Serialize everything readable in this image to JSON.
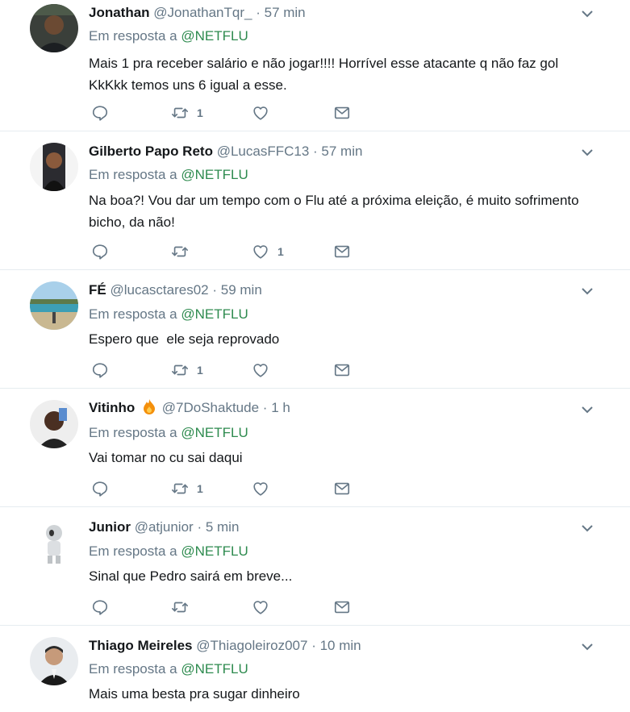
{
  "tweets": [
    {
      "name": "Jonathan",
      "handle": "@JonathanTqr_",
      "sep": "·",
      "time": "57 min",
      "reply_prefix": "Em resposta a",
      "reply_to": "@NETFLU",
      "lines": [
        "Mais 1 pra receber salário e não jogar!!!! Horrível esse atacante q não faz gol",
        "KkKkk temos uns 6 igual a esse."
      ],
      "retweets": "1",
      "likes": ""
    },
    {
      "name": "Gilberto Papo Reto",
      "handle": "@LucasFFC13",
      "sep": "·",
      "time": "57 min",
      "reply_prefix": "Em resposta a",
      "reply_to": "@NETFLU",
      "lines": [
        "Na boa?! Vou dar um tempo com o Flu até a próxima eleição, é muito sofrimento",
        "bicho, da não!"
      ],
      "retweets": "",
      "likes": "1"
    },
    {
      "name": "FÉ",
      "handle": "@lucasctares02",
      "sep": "·",
      "time": "59 min",
      "reply_prefix": "Em resposta a",
      "reply_to": "@NETFLU",
      "lines": [
        "Espero que  ele seja reprovado"
      ],
      "retweets": "1",
      "likes": ""
    },
    {
      "name": "Vitinho",
      "handle": "@7DoShaktude",
      "sep": "·",
      "time": "1 h",
      "reply_prefix": "Em resposta a",
      "reply_to": "@NETFLU",
      "lines": [
        "Vai tomar no cu sai daqui"
      ],
      "retweets": "1",
      "likes": ""
    },
    {
      "name": "Junior",
      "handle": "@atjunior",
      "sep": "·",
      "time": "5 min",
      "reply_prefix": "Em resposta a",
      "reply_to": "@NETFLU",
      "lines": [
        "Sinal que Pedro sairá em breve..."
      ],
      "retweets": "",
      "likes": ""
    },
    {
      "name": "Thiago Meireles",
      "handle": "@Thiagoleiroz007",
      "sep": "·",
      "time": "10 min",
      "reply_prefix": "Em resposta a",
      "reply_to": "@NETFLU",
      "lines": [
        "Mais uma besta pra sugar dinheiro"
      ],
      "retweets": "",
      "likes": ""
    }
  ],
  "icons": {
    "reply": "reply-icon",
    "retweet": "retweet-icon",
    "like": "heart-icon",
    "dm": "envelope-icon",
    "menu": "chevron-down-icon",
    "emoji": "fire-icon"
  },
  "colors": {
    "icon": "#657786",
    "mention": "#2e8b4f",
    "divider": "#e6ecf0"
  }
}
